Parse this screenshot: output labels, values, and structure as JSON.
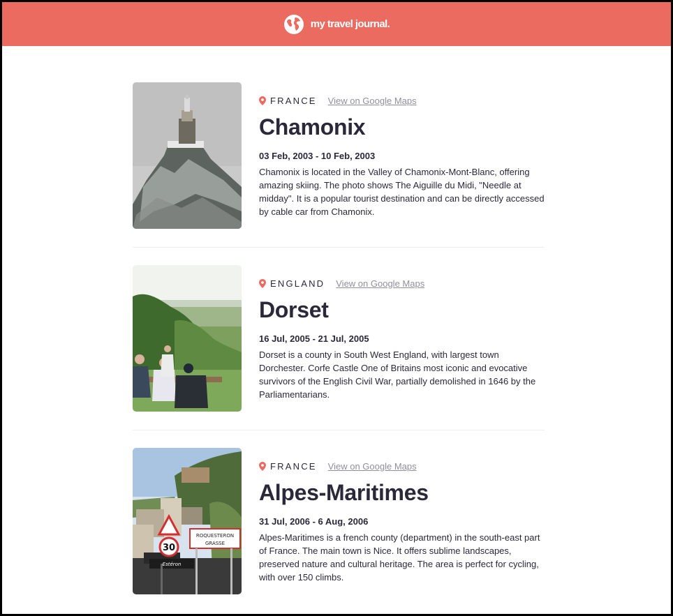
{
  "header": {
    "brand": "my travel journal.",
    "icon": "globe-icon",
    "color": "#eb6b61"
  },
  "entries": [
    {
      "country": "FRANCE",
      "maps_link": "View on Google Maps",
      "title": "Chamonix",
      "dates": "03 Feb, 2003 - 10 Feb, 2003",
      "description": "Chamonix is located in the Valley of Chamonix-Mont-Blanc, offering amazing skiing. The photo shows The Aiguille du Midi, \"Needle at midday\". It is a popular tourist destination and can be directly accessed by cable car from Chamonix."
    },
    {
      "country": "ENGLAND",
      "maps_link": "View on Google Maps",
      "title": "Dorset",
      "dates": "16 Jul, 2005 - 21 Jul, 2005",
      "description": "Dorset is a county in South West England, with largest town Dorchester. Corfe Castle One of Britains most iconic and evocative survivors of the English Civil War, partially demolished in 1646 by the Parliamentarians."
    },
    {
      "country": "FRANCE",
      "maps_link": "View on Google Maps",
      "title": "Alpes-Maritimes",
      "dates": "31 Jul, 2006 - 6 Aug, 2006",
      "description": "Alpes-Maritimes is a french county (department) in the south-east part of France. The main town is Nice. It offers sublime landscapes, preserved nature and cultural heritage. The area is perfect for cycling, with over 150 climbs.",
      "sign_text": [
        "ROQUESTERON",
        "GRASSE"
      ],
      "speed_sign": "30",
      "river_sign": "Estéron"
    }
  ]
}
